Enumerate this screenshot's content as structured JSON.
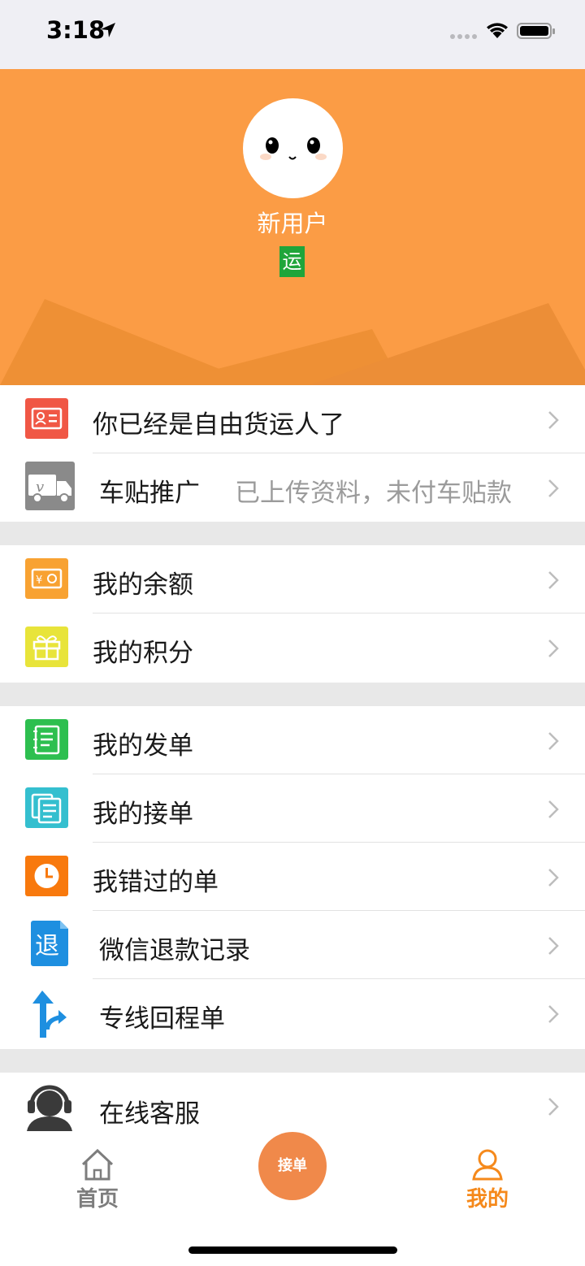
{
  "status": {
    "time": "3:18"
  },
  "profile": {
    "username": "新用户",
    "badge": "运"
  },
  "sections": [
    [
      {
        "label": "你已经是自由货运人了",
        "sub": "",
        "icon": "id-card-icon",
        "color": "#f05745"
      },
      {
        "label": "车贴推广",
        "sub": "已上传资料，未付车贴款",
        "icon": "truck-icon",
        "color": "#8a8a8a"
      }
    ],
    [
      {
        "label": "我的余额",
        "sub": "",
        "icon": "wallet-icon",
        "color": "#f8a232"
      },
      {
        "label": "我的积分",
        "sub": "",
        "icon": "gift-icon",
        "color": "#e8e43a"
      }
    ],
    [
      {
        "label": "我的发单",
        "sub": "",
        "icon": "notebook-icon",
        "color": "#2dbf4f"
      },
      {
        "label": "我的接单",
        "sub": "",
        "icon": "documents-icon",
        "color": "#34bfcf"
      },
      {
        "label": "我错过的单",
        "sub": "",
        "icon": "clock-icon",
        "color": "#f8790d"
      },
      {
        "label": "微信退款记录",
        "sub": "",
        "icon": "refund-icon",
        "color": "#1e8fe0"
      },
      {
        "label": "专线回程单",
        "sub": "",
        "icon": "route-arrow-icon",
        "color": "#1e8fe0"
      }
    ],
    [
      {
        "label": "在线客服",
        "sub": "",
        "icon": "customer-service-icon",
        "color": "#3a3a3a"
      }
    ]
  ],
  "tabs": {
    "home": "首页",
    "center": "接单",
    "mine": "我的"
  },
  "colors": {
    "header": "#fb9c45",
    "accent": "#f5891b",
    "badge": "#1fa53a"
  }
}
